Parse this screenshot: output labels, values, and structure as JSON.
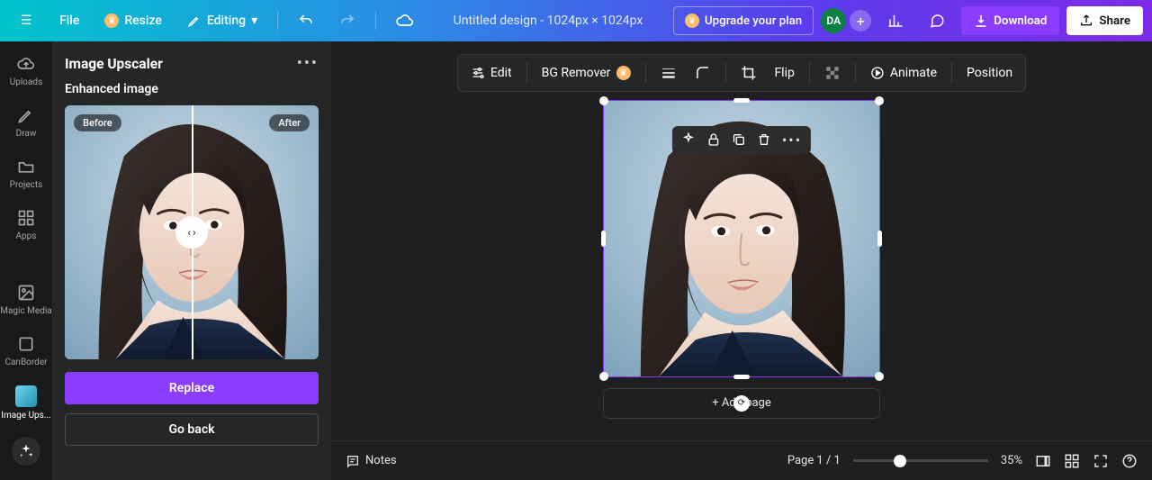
{
  "header": {
    "file": "File",
    "resize": "Resize",
    "editing": "Editing",
    "title": "Untitled design - 1024px × 1024px",
    "upgrade": "Upgrade your plan",
    "avatar": "DA",
    "download": "Download",
    "share": "Share"
  },
  "rail": {
    "uploads": "Uploads",
    "draw": "Draw",
    "projects": "Projects",
    "apps": "Apps",
    "magic": "Magic Media",
    "canborder": "CanBorder",
    "imageups": "Image Ups..."
  },
  "panel": {
    "title": "Image Upscaler",
    "subtitle": "Enhanced image",
    "before": "Before",
    "after": "After",
    "replace": "Replace",
    "goback": "Go back"
  },
  "ctx": {
    "edit": "Edit",
    "bgremover": "BG Remover",
    "flip": "Flip",
    "animate": "Animate",
    "position": "Position"
  },
  "canvas": {
    "addpage": "+ Add page"
  },
  "bottom": {
    "notes": "Notes",
    "pages": "Page 1 / 1",
    "zoom": "35%"
  }
}
